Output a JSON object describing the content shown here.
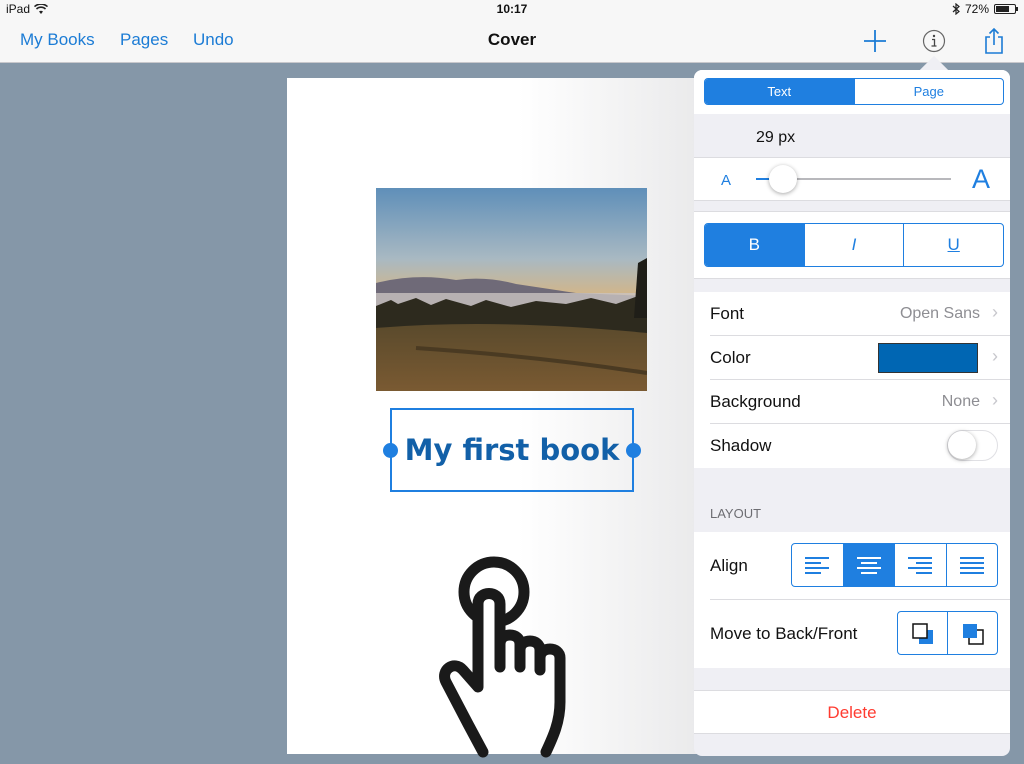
{
  "status_bar": {
    "device": "iPad",
    "time": "10:17",
    "battery": "72%",
    "battery_level": 0.72
  },
  "nav": {
    "my_books": "My Books",
    "pages": "Pages",
    "undo": "Undo",
    "title": "Cover"
  },
  "page": {
    "text_box": "My first book"
  },
  "inspector": {
    "tabs": [
      {
        "label": "Text",
        "active": true
      },
      {
        "label": "Page",
        "active": false
      }
    ],
    "font_size": "29 px",
    "size_slider": {
      "small_label": "A",
      "large_label": "A",
      "level": 0.14
    },
    "styles": {
      "bold": "B",
      "italic": "I",
      "underline": "U",
      "active": "bold"
    },
    "font": {
      "label": "Font",
      "value": "Open Sans"
    },
    "color": {
      "label": "Color",
      "value": "#0066b3"
    },
    "background": {
      "label": "Background",
      "value": "None"
    },
    "shadow": {
      "label": "Shadow",
      "enabled": false
    },
    "layout_header": "LAYOUT",
    "align": {
      "label": "Align",
      "options": [
        "left",
        "center",
        "right",
        "justify"
      ],
      "active": "center"
    },
    "move": {
      "label": "Move to Back/Front",
      "options": [
        "back",
        "front"
      ]
    },
    "delete_label": "Delete"
  },
  "colors": {
    "accent": "#1f7fe0",
    "delete": "#ff3b30",
    "title_text": "#1260a8"
  }
}
